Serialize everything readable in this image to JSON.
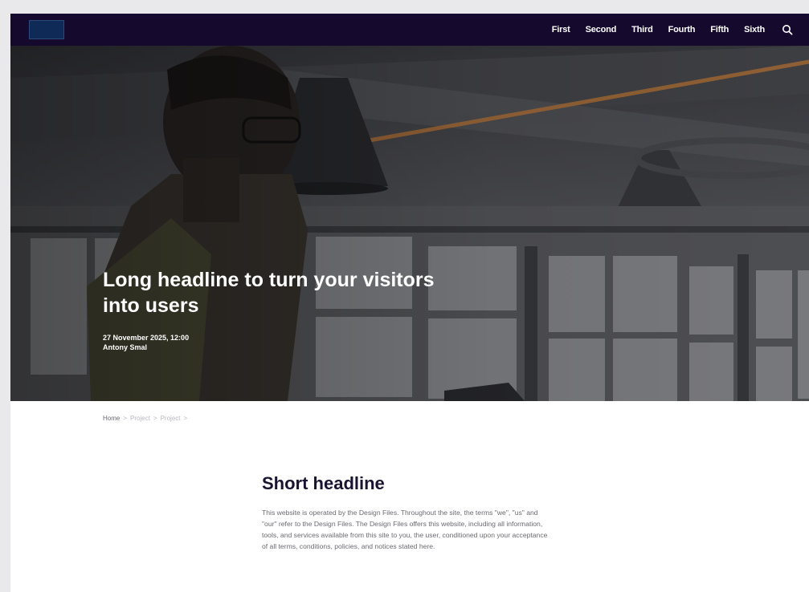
{
  "nav": {
    "links": [
      "First",
      "Second",
      "Third",
      "Fourth",
      "Fifth",
      "Sixth"
    ],
    "search_icon": "search-icon"
  },
  "hero": {
    "title": "Long headline to turn your visitors into users",
    "date": "27 November 2025, 12:00",
    "author": "Antony Smal"
  },
  "breadcrumb": {
    "home": "Home",
    "items": [
      "Project",
      "Project"
    ],
    "separator": ">"
  },
  "content": {
    "title": "Short headline",
    "body": "This website is operated by the Design Files. Throughout the site, the terms \"we\", \"us\" and \"our\" refer to the Design Files. The Design Files offers this website, including all information, tools, and services available from this site to you, the user, conditioned upon your acceptance of all terms, conditions, policies, and notices stated here."
  },
  "colors": {
    "navbar": "#150a2e",
    "logo": "#0f2a57",
    "heading": "#1a1430",
    "body_text": "#6a6a72"
  }
}
